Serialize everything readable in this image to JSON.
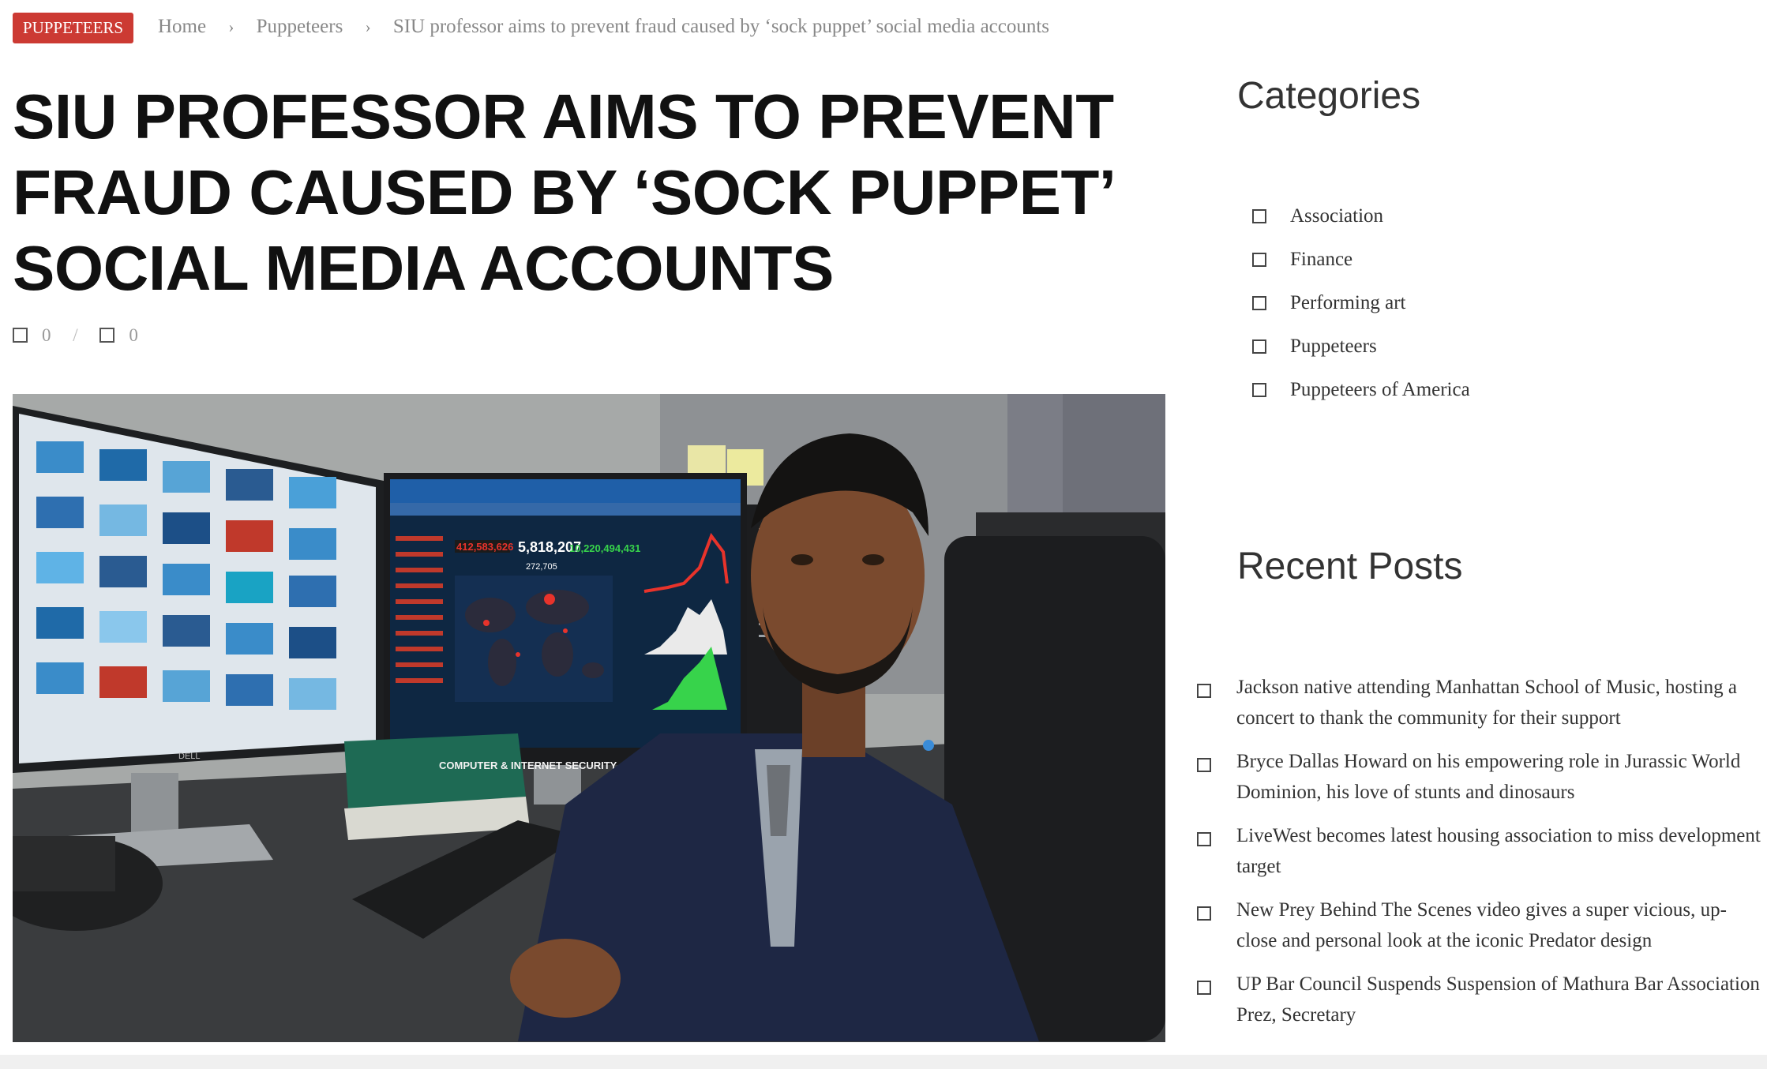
{
  "badge": "PUPPETEERS",
  "breadcrumb": {
    "home": "Home",
    "category": "Puppeteers",
    "current": "SIU professor aims to prevent fraud caused by ‘sock puppet’ social media accounts",
    "separator": "›"
  },
  "article": {
    "title": "SIU PROFESSOR AIMS TO PREVENT FRAUD CAUSED BY ‘SOCK PUPPET’ SOCIAL MEDIA ACCOUNTS",
    "meta": {
      "first_count": "0",
      "divider": "/",
      "second_count": "0"
    }
  },
  "photo_text": {
    "dashboard_total": "5,818,207",
    "dashboard_red": "412,583,626",
    "dashboard_green": "10,220,494,431",
    "dashboard_sub": "272,705",
    "book_title": "COMPUTER & INTERNET SECURITY",
    "monitor_brand": "DELL"
  },
  "sidebar": {
    "categories_heading": "Categories",
    "categories": [
      "Association",
      "Finance",
      "Performing art",
      "Puppeteers",
      "Puppeteers of America"
    ],
    "recent_heading": "Recent Posts",
    "recent_posts": [
      "Jackson native attending Manhattan School of Music, hosting a concert to thank the community for their support",
      "Bryce Dallas Howard on his empowering role in Jurassic World Dominion, his love of stunts and dinosaurs",
      "LiveWest becomes latest housing association to miss development target",
      "New Prey Behind The Scenes video gives a super vicious, up-close and personal look at the iconic Predator design",
      "UP Bar Council Suspends Suspension of Mathura Bar Association Prez, Secretary"
    ]
  },
  "colors": {
    "badge": "#cc3a33",
    "text": "#111111",
    "muted": "#888888"
  },
  "icons": [
    "comment-icon",
    "view-icon",
    "checkbox-bullet-icon"
  ]
}
